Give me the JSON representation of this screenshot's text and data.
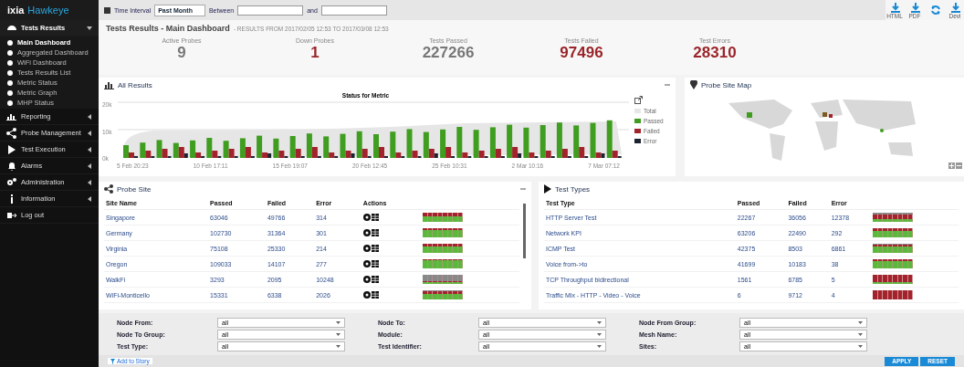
{
  "brand": {
    "name": "ixia",
    "product": "Hawkeye"
  },
  "sidebar": {
    "items": [
      {
        "label": "Tests Results",
        "expanded": true,
        "children": [
          {
            "label": "Main Dashboard",
            "selected": true
          },
          {
            "label": "Aggregated Dashboard",
            "selected": false
          },
          {
            "label": "WiFi Dashboard",
            "selected": false
          },
          {
            "label": "Tests Results List",
            "selected": false
          },
          {
            "label": "Metric Status",
            "selected": false
          },
          {
            "label": "Metric Graph",
            "selected": false
          },
          {
            "label": "MHP Status",
            "selected": false
          }
        ]
      },
      {
        "label": "Reporting",
        "expanded": false
      },
      {
        "label": "Probe Management",
        "expanded": false
      },
      {
        "label": "Test Execution",
        "expanded": false
      },
      {
        "label": "Alarms",
        "expanded": false
      },
      {
        "label": "Administration",
        "expanded": false
      },
      {
        "label": "Information",
        "expanded": false
      },
      {
        "label": "Log out"
      }
    ]
  },
  "toolbar": {
    "time_interval_label": "Time Interval",
    "time_interval": "Past Month",
    "between_label": "Between",
    "and_label": "and",
    "actions": [
      {
        "kind": "download",
        "label": "HTML"
      },
      {
        "kind": "download",
        "label": "PDF"
      },
      {
        "kind": "refresh"
      },
      {
        "kind": "download",
        "label": "Devi"
      }
    ]
  },
  "page": {
    "title": "Tests Results - Main Dashboard",
    "subtitle": "- RESULTS FROM 2017/02/05 12:53 TO 2017/03/08 12:53"
  },
  "stats": [
    {
      "label": "Active Probes",
      "value": "9",
      "alert": false
    },
    {
      "label": "Down Probes",
      "value": "1",
      "alert": true
    },
    {
      "label": "Tests Passed",
      "value": "227266",
      "alert": false
    },
    {
      "label": "Tests Failed",
      "value": "97496",
      "alert": true
    },
    {
      "label": "Test Errors",
      "value": "28310",
      "alert": true
    }
  ],
  "all_results": {
    "title": "All Results",
    "chart_title": "Status for Metric",
    "yticks": [
      "20k",
      "10k",
      "0k"
    ],
    "xlabels": [
      "5 Feb 20:23",
      "10 Feb 17:11",
      "15 Feb 19:07",
      "20 Feb 12:45",
      "25 Feb 10:31",
      "2 Mar 10:16",
      "7 Mar 07:12"
    ],
    "legend": [
      {
        "label": "Total",
        "color": "#e6e6e6"
      },
      {
        "label": "Passed",
        "color": "#3f9d1f"
      },
      {
        "label": "Failed",
        "color": "#a3232c"
      },
      {
        "label": "Error",
        "color": "#1b2230"
      }
    ]
  },
  "map": {
    "title": "Probe Site Map"
  },
  "probe_site": {
    "title": "Probe Site",
    "columns": [
      "Site Name",
      "Passed",
      "Failed",
      "Error",
      "Actions"
    ],
    "rows": [
      {
        "site": "Singapore",
        "passed": "63046",
        "failed": "49766",
        "error": "314"
      },
      {
        "site": "Germany",
        "passed": "102730",
        "failed": "31364",
        "error": "301"
      },
      {
        "site": "Virginia",
        "passed": "75108",
        "failed": "25330",
        "error": "214"
      },
      {
        "site": "Oregon",
        "passed": "109033",
        "failed": "14107",
        "error": "277"
      },
      {
        "site": "WalkFi",
        "passed": "3293",
        "failed": "2095",
        "error": "10248"
      },
      {
        "site": "WiFi-Monticello",
        "passed": "15331",
        "failed": "6338",
        "error": "2026"
      }
    ]
  },
  "test_types": {
    "title": "Test Types",
    "columns": [
      "Test Type",
      "Passed",
      "Failed",
      "Error"
    ],
    "rows": [
      {
        "type": "HTTP Server Test",
        "passed": "22267",
        "failed": "36056",
        "error": "12378"
      },
      {
        "type": "Network KPI",
        "passed": "63206",
        "failed": "22490",
        "error": "292"
      },
      {
        "type": "ICMP Test",
        "passed": "42375",
        "failed": "8503",
        "error": "6861"
      },
      {
        "type": "Voice from->to",
        "passed": "41699",
        "failed": "10183",
        "error": "38"
      },
      {
        "type": "TCP Throughput bidirectional",
        "passed": "1561",
        "failed": "6785",
        "error": "5"
      },
      {
        "type": "Traffic Mix - HTTP - Video - Voice",
        "passed": "6",
        "failed": "9712",
        "error": "4"
      }
    ]
  },
  "filters": [
    {
      "label": "Node From:",
      "value": "all"
    },
    {
      "label": "Node To:",
      "value": "all"
    },
    {
      "label": "Node From Group:",
      "value": "all"
    },
    {
      "label": "Node To Group:",
      "value": "all"
    },
    {
      "label": "Module:",
      "value": "all"
    },
    {
      "label": "Mesh Name:",
      "value": "all"
    },
    {
      "label": "Test Type:",
      "value": "all"
    },
    {
      "label": "Test Identifier:",
      "value": "all"
    },
    {
      "label": "Sites:",
      "value": "all"
    }
  ],
  "footer": {
    "link": "Add to Story",
    "buttons": [
      "APPLY",
      "RESET"
    ]
  }
}
